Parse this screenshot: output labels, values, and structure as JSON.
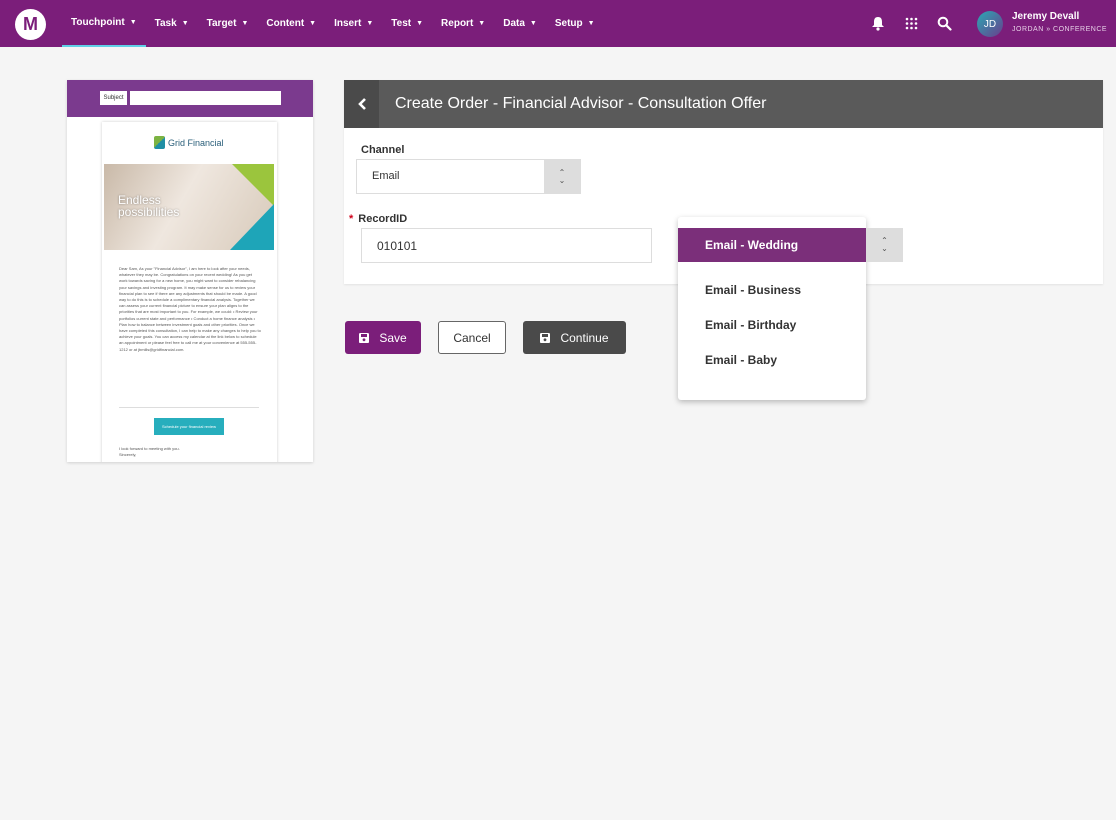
{
  "nav": {
    "logo": "M",
    "items": [
      "Touchpoint",
      "Task",
      "Target",
      "Content",
      "Insert",
      "Test",
      "Report",
      "Data",
      "Setup"
    ]
  },
  "user": {
    "initials": "JD",
    "name": "Jeremy Devall",
    "context": "JORDAN » CONFERENCE"
  },
  "preview": {
    "subject_label": "Subject",
    "brand": "Grid Financial",
    "hero_text": "Endless possibilities",
    "body": "Dear Sam, As your \"Financial Advisor\", I am here to look after your needs, whatever they may be. Congratulations on your recent wedding! As you get work towards saving for a new home, you might want to consider rebalancing your savings and investing program. It may make sense for us to review your financial plan to see if there are any adjustments that should be made. A good way to do this is to schedule a complimentary financial analysis. Together we can assess your current financial picture to ensure your plan aligns to the priorities that are most important to you. For example, we could: • Review your portfolios current state and performance • Conduct a home finance analysis • Plan how to balance between investment goals and other priorities. Once we have completed this consultation, I can help to make any changes to help you to achieve your goals. You can access my calendar at the link below to schedule an appointment or please feel free to call me at your convenience at 555-555-1212 or at jbmills@gridfinancial.com.",
    "cta": "Schedule your financial review",
    "signoff": "I look forward to meeting with you.",
    "closing": "Sincerely,"
  },
  "panel": {
    "title": "Create Order - Financial Advisor - Consultation Offer",
    "channel_label": "Channel",
    "channel_value": "Email",
    "record_label": "RecordID",
    "record_value": "010101"
  },
  "dropdown": {
    "options": [
      "Email - Wedding",
      "Email - Business",
      "Email - Birthday",
      "Email - Baby"
    ],
    "selected": "Email - Wedding"
  },
  "buttons": {
    "save": "Save",
    "cancel": "Cancel",
    "continue": "Continue"
  },
  "colors": {
    "brand": "#7b1e7a",
    "header_dark": "#5a5a5a",
    "accent": "#27aebd"
  }
}
